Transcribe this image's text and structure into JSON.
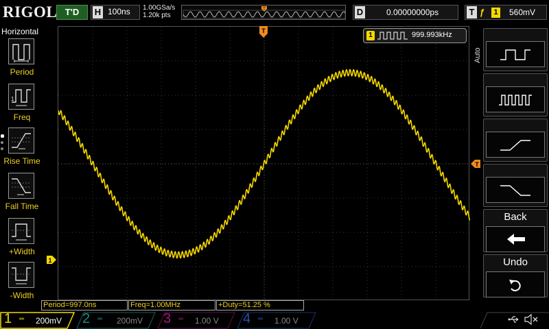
{
  "top": {
    "logo": "RIGOL",
    "trigger_state": "T'D",
    "horizontal_label": "H",
    "timebase": "100ns",
    "sample_rate": "1.00GSa/s",
    "memory_depth": "1.20k pts",
    "delay_label": "D",
    "delay": "0.00000000ps",
    "trigger_label": "T",
    "trigger_edge": "ƒ",
    "trigger_channel": "1",
    "trigger_level": "560mV"
  },
  "left_menu": {
    "title": "Horizontal",
    "items": [
      {
        "label": "Period",
        "icon": "period-icon"
      },
      {
        "label": "Freq",
        "icon": "frequency-icon"
      },
      {
        "label": "Rise Time",
        "icon": "rise-time-icon"
      },
      {
        "label": "Fall Time",
        "icon": "fall-time-icon"
      },
      {
        "label": "+Width",
        "icon": "positive-width-icon"
      },
      {
        "label": "-Width",
        "icon": "negative-width-icon"
      }
    ]
  },
  "freq_counter": {
    "channel": "1",
    "value": "999.993kHz"
  },
  "right_menu": {
    "mode_label": "Auto",
    "back_label": "Back",
    "undo_label": "Undo",
    "buttons": [
      "square-wave-icon",
      "pulse-train-icon",
      "rising-edge-icon",
      "falling-edge-icon"
    ]
  },
  "measurements": [
    {
      "label": "Period=997.0ns"
    },
    {
      "label": "Freq=1.00MHz"
    },
    {
      "label": "+Duty=51.25 %"
    }
  ],
  "channels": [
    {
      "num": "1",
      "scale": "200mV",
      "color": "#f5d800",
      "active": true
    },
    {
      "num": "2",
      "scale": "200mV",
      "color": "#1d8b86",
      "active": false
    },
    {
      "num": "3",
      "scale": "1.00 V",
      "color": "#a0167a",
      "active": false
    },
    {
      "num": "4",
      "scale": "1.00 V",
      "color": "#2a4fb0",
      "active": false
    }
  ],
  "colors": {
    "trace": "#f5d800",
    "marker": "#f08a1f",
    "menu_text": "#f0cf1f"
  }
}
